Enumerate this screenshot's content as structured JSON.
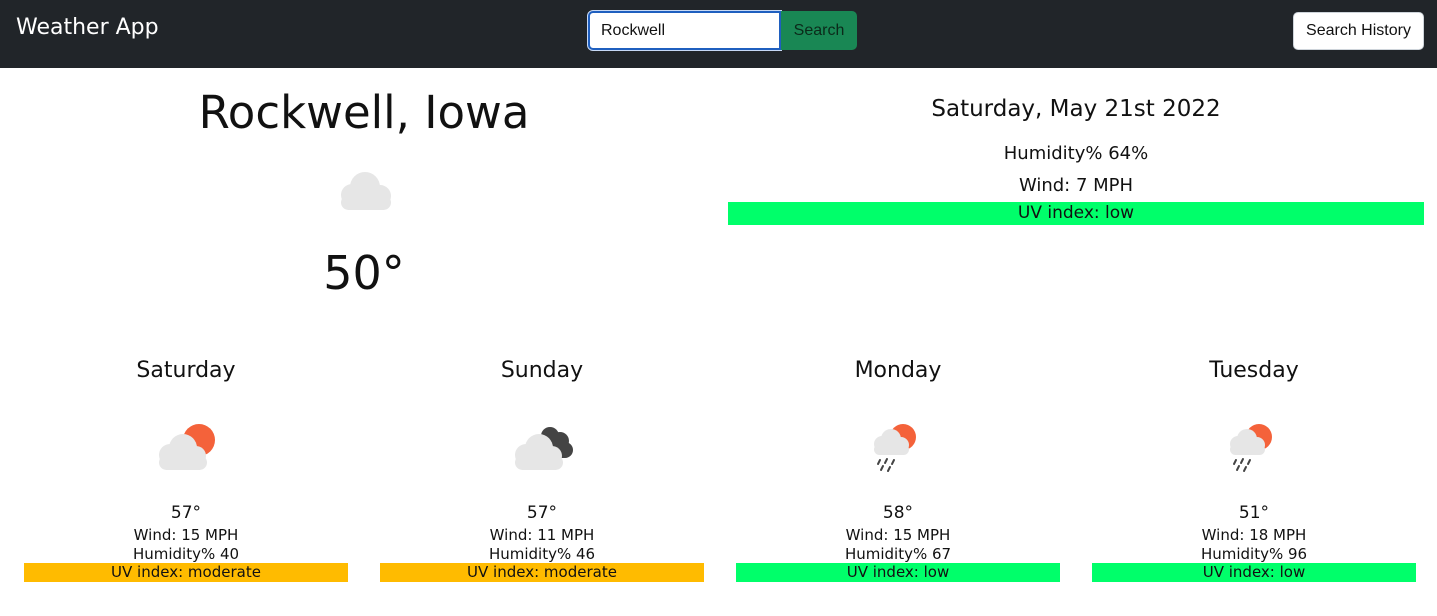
{
  "navbar": {
    "brand": "Weather App",
    "search_value": "Rockwell",
    "search_button": "Search",
    "history_button": "Search History"
  },
  "current": {
    "city": "Rockwell, Iowa",
    "icon": "cloud-icon",
    "temp": "50°",
    "date": "Saturday, May 21st 2022",
    "humidity": "Humidity% 64%",
    "wind": "Wind: 7 MPH",
    "uv": "UV index: low"
  },
  "forecast": [
    {
      "day": "Saturday",
      "icon": "partly-cloudy-sun-icon",
      "temp": "57°",
      "wind": "Wind: 15 MPH",
      "humidity": "Humidity% 40",
      "uv": "UV index: moderate"
    },
    {
      "day": "Sunday",
      "icon": "dark-clouds-icon",
      "temp": "57°",
      "wind": "Wind: 11 MPH",
      "humidity": "Humidity% 46",
      "uv": "UV index: moderate"
    },
    {
      "day": "Monday",
      "icon": "rain-sun-icon",
      "temp": "58°",
      "wind": "Wind: 15 MPH",
      "humidity": "Humidity% 67",
      "uv": "UV index: low"
    },
    {
      "day": "Tuesday",
      "icon": "rain-sun-icon",
      "temp": "51°",
      "wind": "Wind: 18 MPH",
      "humidity": "Humidity% 96",
      "uv": "UV index: low"
    }
  ],
  "colors": {
    "navbar": "#212529",
    "search_button": "#198754",
    "uv_low": "#00ff6a",
    "uv_moderate": "#ffbb00",
    "sun": "#f4623a",
    "cloud_light": "#e6e6e6",
    "cloud_dark": "#444444"
  }
}
